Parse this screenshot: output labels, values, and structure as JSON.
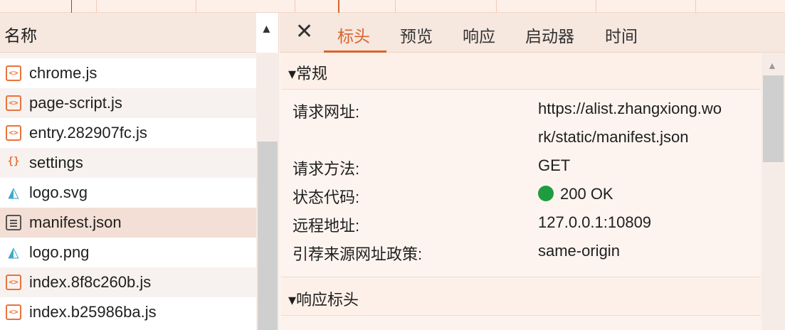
{
  "network_panel": {
    "file_list": {
      "column_header": "名称",
      "sort_icon": "triangle-up-icon",
      "items": [
        {
          "name": "chrome.js",
          "icon": "js-file-icon"
        },
        {
          "name": "page-script.js",
          "icon": "js-file-icon"
        },
        {
          "name": "entry.282907fc.js",
          "icon": "js-file-icon"
        },
        {
          "name": "settings",
          "icon": "json-file-icon"
        },
        {
          "name": "logo.svg",
          "icon": "image-file-icon"
        },
        {
          "name": "manifest.json",
          "icon": "document-file-icon"
        },
        {
          "name": "logo.png",
          "icon": "image-file-icon"
        },
        {
          "name": "index.8f8c260b.js",
          "icon": "js-file-icon"
        },
        {
          "name": "index.b25986ba.js",
          "icon": "js-file-icon"
        }
      ]
    },
    "details": {
      "close_icon": "close-icon",
      "tabs": [
        {
          "label": "标头",
          "active": true
        },
        {
          "label": "预览",
          "active": false
        },
        {
          "label": "响应",
          "active": false
        },
        {
          "label": "启动器",
          "active": false
        },
        {
          "label": "时间",
          "active": false
        }
      ],
      "general": {
        "title": "▾常规",
        "request_url_label": "请求网址:",
        "request_url_line1": "https://alist.zhangxiong.wo",
        "request_url_line2": "rk/static/manifest.json",
        "method_label": "请求方法:",
        "method_value": "GET",
        "status_label": "状态代码:",
        "status_value": "200 OK",
        "status_color": "#1f9c3f",
        "remote_label": "远程地址:",
        "remote_value": "127.0.0.1:10809",
        "referrer_label": "引荐来源网址政策:",
        "referrer_value": "same-origin"
      },
      "response_headers": {
        "title": "▾响应标头"
      }
    },
    "colors": {
      "accent": "#d9642b",
      "selected_row": "#f3dfd5",
      "header_bg": "#f6e7df"
    }
  }
}
